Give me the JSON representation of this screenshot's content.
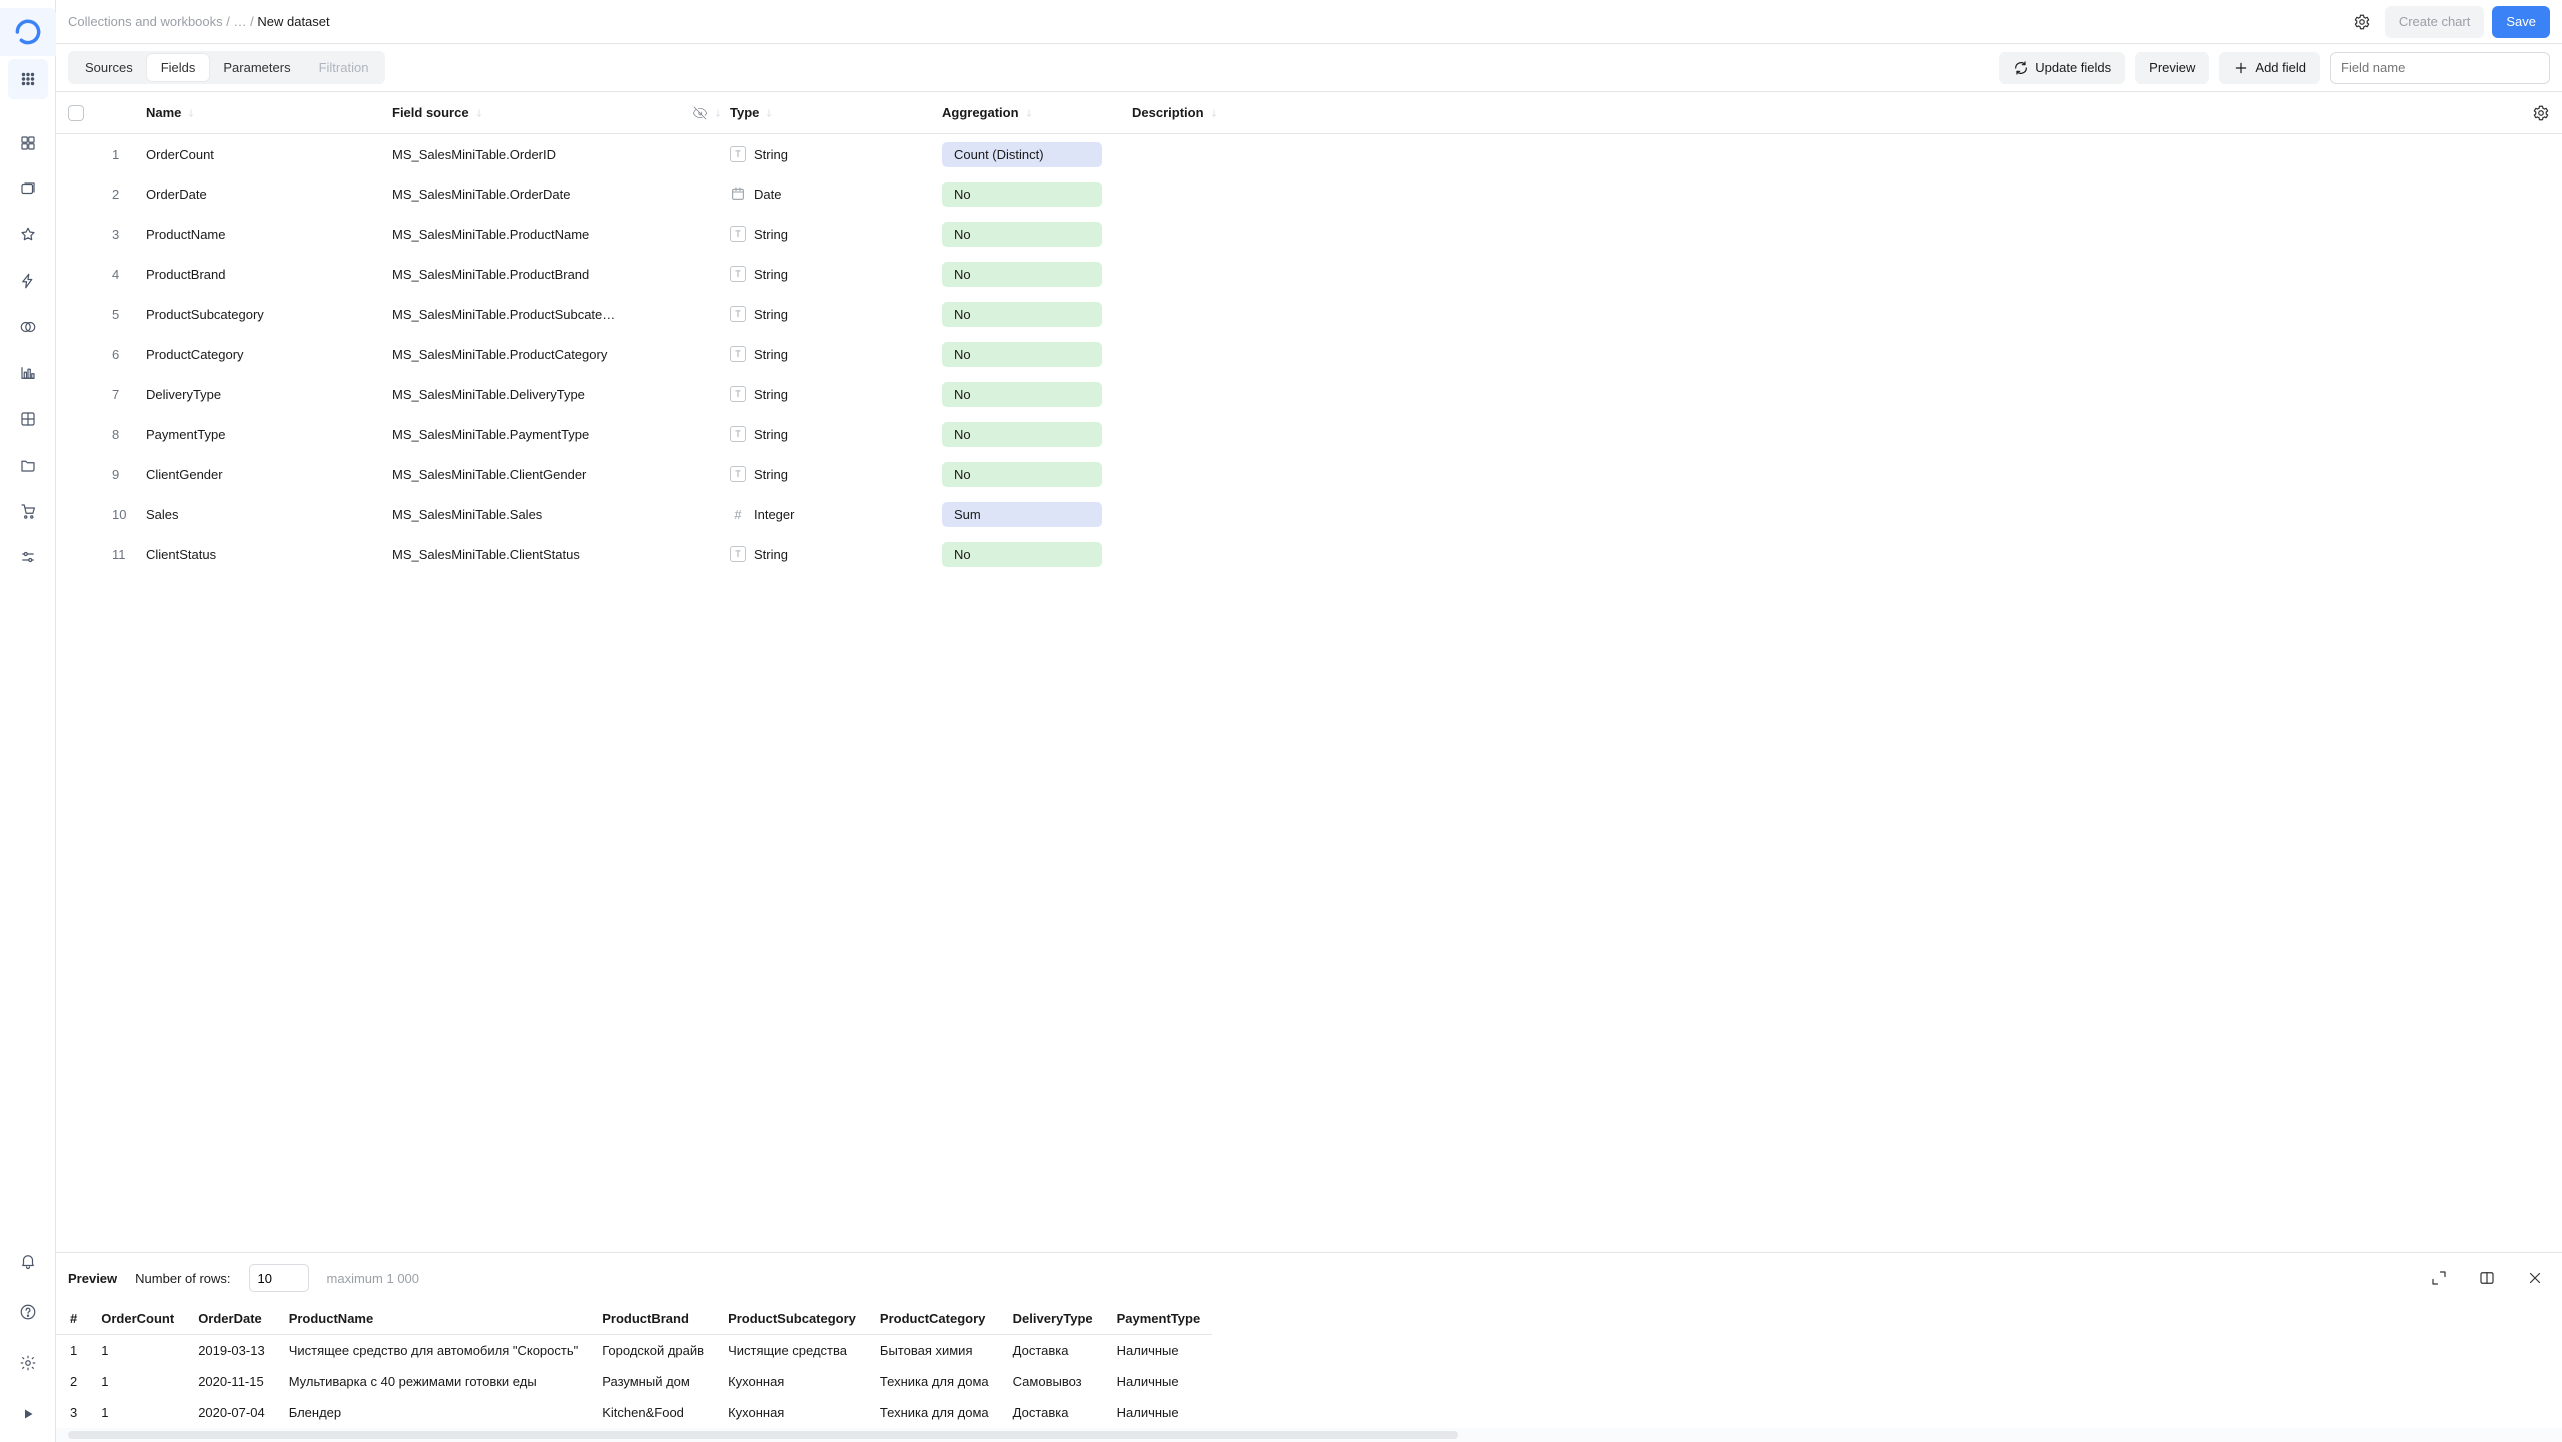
{
  "breadcrumb": {
    "root": "Collections and workbooks",
    "mid": "…",
    "current": "New dataset"
  },
  "topbar": {
    "create_chart": "Create chart",
    "save": "Save"
  },
  "tabs": {
    "sources": "Sources",
    "fields": "Fields",
    "parameters": "Parameters",
    "filtration": "Filtration"
  },
  "toolbar": {
    "update": "Update fields",
    "preview": "Preview",
    "add": "Add field",
    "search_placeholder": "Field name"
  },
  "columns": {
    "name": "Name",
    "source": "Field source",
    "type": "Type",
    "agg": "Aggregation",
    "desc": "Description"
  },
  "rows": [
    {
      "n": "1",
      "name": "OrderCount",
      "source": "MS_SalesMiniTable.OrderID",
      "type": "String",
      "typicon": "T",
      "agg": "Count (Distinct)",
      "agg_k": "agg"
    },
    {
      "n": "2",
      "name": "OrderDate",
      "source": "MS_SalesMiniTable.OrderDate",
      "type": "Date",
      "typicon": "D",
      "agg": "No",
      "agg_k": "no"
    },
    {
      "n": "3",
      "name": "ProductName",
      "source": "MS_SalesMiniTable.ProductName",
      "type": "String",
      "typicon": "T",
      "agg": "No",
      "agg_k": "no"
    },
    {
      "n": "4",
      "name": "ProductBrand",
      "source": "MS_SalesMiniTable.ProductBrand",
      "type": "String",
      "typicon": "T",
      "agg": "No",
      "agg_k": "no"
    },
    {
      "n": "5",
      "name": "ProductSubcategory",
      "source": "MS_SalesMiniTable.ProductSubcate…",
      "type": "String",
      "typicon": "T",
      "agg": "No",
      "agg_k": "no"
    },
    {
      "n": "6",
      "name": "ProductCategory",
      "source": "MS_SalesMiniTable.ProductCategory",
      "type": "String",
      "typicon": "T",
      "agg": "No",
      "agg_k": "no"
    },
    {
      "n": "7",
      "name": "DeliveryType",
      "source": "MS_SalesMiniTable.DeliveryType",
      "type": "String",
      "typicon": "T",
      "agg": "No",
      "agg_k": "no"
    },
    {
      "n": "8",
      "name": "PaymentType",
      "source": "MS_SalesMiniTable.PaymentType",
      "type": "String",
      "typicon": "T",
      "agg": "No",
      "agg_k": "no"
    },
    {
      "n": "9",
      "name": "ClientGender",
      "source": "MS_SalesMiniTable.ClientGender",
      "type": "String",
      "typicon": "T",
      "agg": "No",
      "agg_k": "no"
    },
    {
      "n": "10",
      "name": "Sales",
      "source": "MS_SalesMiniTable.Sales",
      "type": "Integer",
      "typicon": "#",
      "agg": "Sum",
      "agg_k": "agg"
    },
    {
      "n": "11",
      "name": "ClientStatus",
      "source": "MS_SalesMiniTable.ClientStatus",
      "type": "String",
      "typicon": "T",
      "agg": "No",
      "agg_k": "no"
    }
  ],
  "preview": {
    "title": "Preview",
    "rows_label": "Number of rows:",
    "rows_value": "10",
    "max_hint": "maximum 1 000",
    "headers": [
      "#",
      "OrderCount",
      "OrderDate",
      "ProductName",
      "ProductBrand",
      "ProductSubcategory",
      "ProductCategory",
      "DeliveryType",
      "PaymentType"
    ],
    "data": [
      [
        "1",
        "1",
        "2019-03-13",
        "Чистящее средство для автомобиля \"Скорость\"",
        "Городской драйв",
        "Чистящие средства",
        "Бытовая химия",
        "Доставка",
        "Наличные"
      ],
      [
        "2",
        "1",
        "2020-11-15",
        "Мультиварка с 40 режимами готовки еды",
        "Разумный дом",
        "Кухонная",
        "Техника для дома",
        "Самовывоз",
        "Наличные"
      ],
      [
        "3",
        "1",
        "2020-07-04",
        "Блендер",
        "Kitchen&Food",
        "Кухонная",
        "Техника для дома",
        "Доставка",
        "Наличные"
      ]
    ]
  }
}
